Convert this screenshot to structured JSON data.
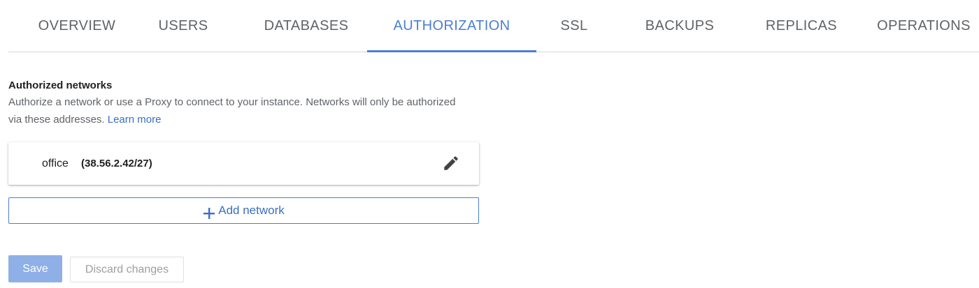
{
  "tabs": [
    {
      "label": "OVERVIEW"
    },
    {
      "label": "USERS"
    },
    {
      "label": "DATABASES"
    },
    {
      "label": "AUTHORIZATION",
      "active": true
    },
    {
      "label": "SSL"
    },
    {
      "label": "BACKUPS"
    },
    {
      "label": "REPLICAS"
    },
    {
      "label": "OPERATIONS"
    }
  ],
  "section": {
    "title": "Authorized networks",
    "description": "Authorize a network or use a Proxy to connect to your instance. Networks will only be authorized via these addresses.",
    "learn_more": "Learn more"
  },
  "networks": [
    {
      "name": "office",
      "address": "(38.56.2.42/27)",
      "edit_icon": "pencil-icon"
    }
  ],
  "add_network": {
    "label": "Add network",
    "icon": "plus-icon"
  },
  "actions": {
    "save_label": "Save",
    "discard_label": "Discard changes"
  },
  "colors": {
    "accent": "#4a7fd1",
    "save_disabled": "#8fb0e6"
  }
}
